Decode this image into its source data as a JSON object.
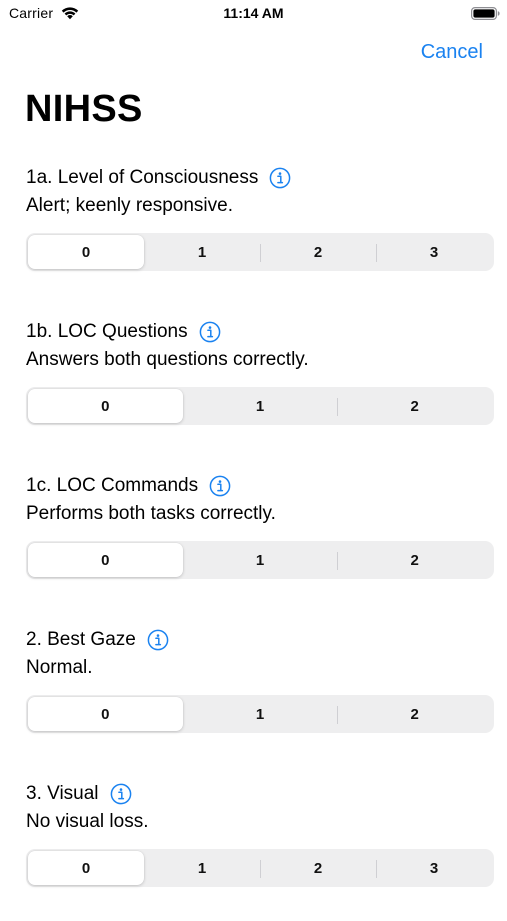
{
  "status_bar": {
    "carrier": "Carrier",
    "time": "11:14 AM"
  },
  "nav": {
    "cancel_label": "Cancel"
  },
  "title": "NIHSS",
  "accent_color": "#1a82f0",
  "sections": [
    {
      "title": "1a. Level of Consciousness",
      "description": "Alert; keenly responsive.",
      "options": [
        "0",
        "1",
        "2",
        "3"
      ],
      "selected_index": 0
    },
    {
      "title": "1b. LOC Questions",
      "description": "Answers both questions correctly.",
      "options": [
        "0",
        "1",
        "2"
      ],
      "selected_index": 0
    },
    {
      "title": "1c. LOC Commands",
      "description": "Performs both tasks correctly.",
      "options": [
        "0",
        "1",
        "2"
      ],
      "selected_index": 0
    },
    {
      "title": "2. Best Gaze",
      "description": "Normal.",
      "options": [
        "0",
        "1",
        "2"
      ],
      "selected_index": 0
    },
    {
      "title": "3. Visual",
      "description": "No visual loss.",
      "options": [
        "0",
        "1",
        "2",
        "3"
      ],
      "selected_index": 0
    }
  ]
}
